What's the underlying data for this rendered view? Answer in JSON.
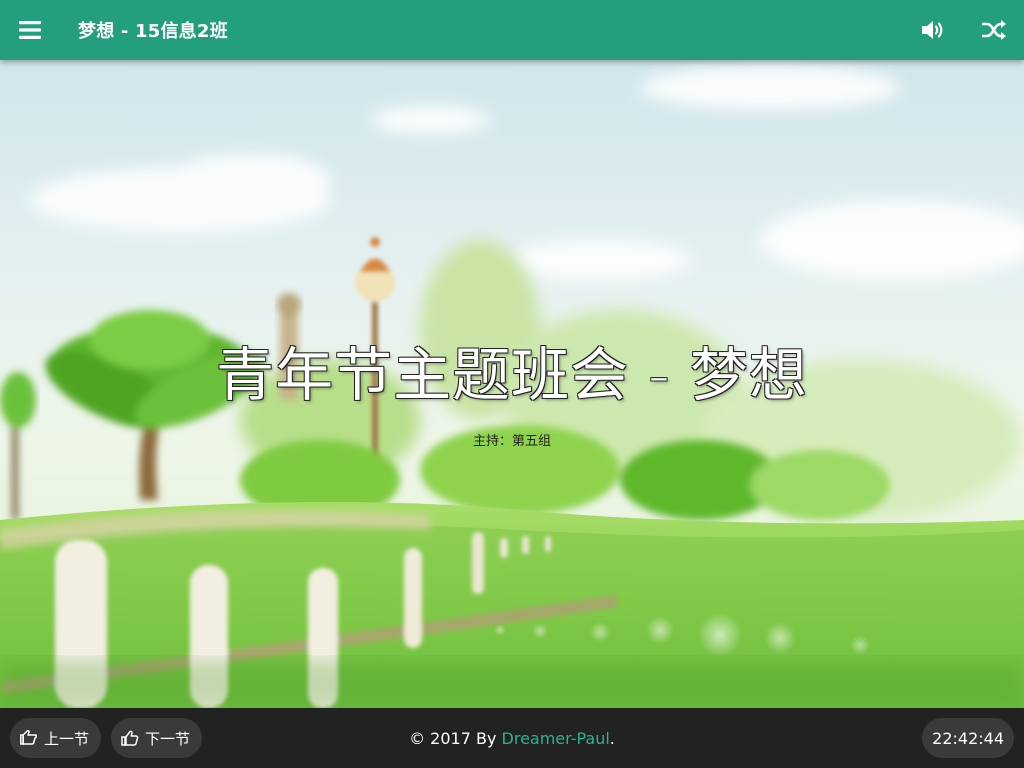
{
  "header": {
    "title": "梦想 - 15信息2班",
    "menu_icon": "hamburger-menu-icon",
    "volume_icon": "volume-up-icon",
    "shuffle_icon": "shuffle-icon",
    "background_color": "#239e7e"
  },
  "slide": {
    "title": "青年节主题班会 - 梦想",
    "subtitle": "主持：第五组"
  },
  "footer": {
    "prev_label": "上一节",
    "next_label": "下一节",
    "prev_icon": "hand-point-left-icon",
    "next_icon": "hand-point-up-icon",
    "copyright_prefix": "© 2017 By ",
    "author": "Dreamer-Paul",
    "copyright_suffix": ".",
    "clock": "22:42:44",
    "author_color": "#29b38f"
  }
}
